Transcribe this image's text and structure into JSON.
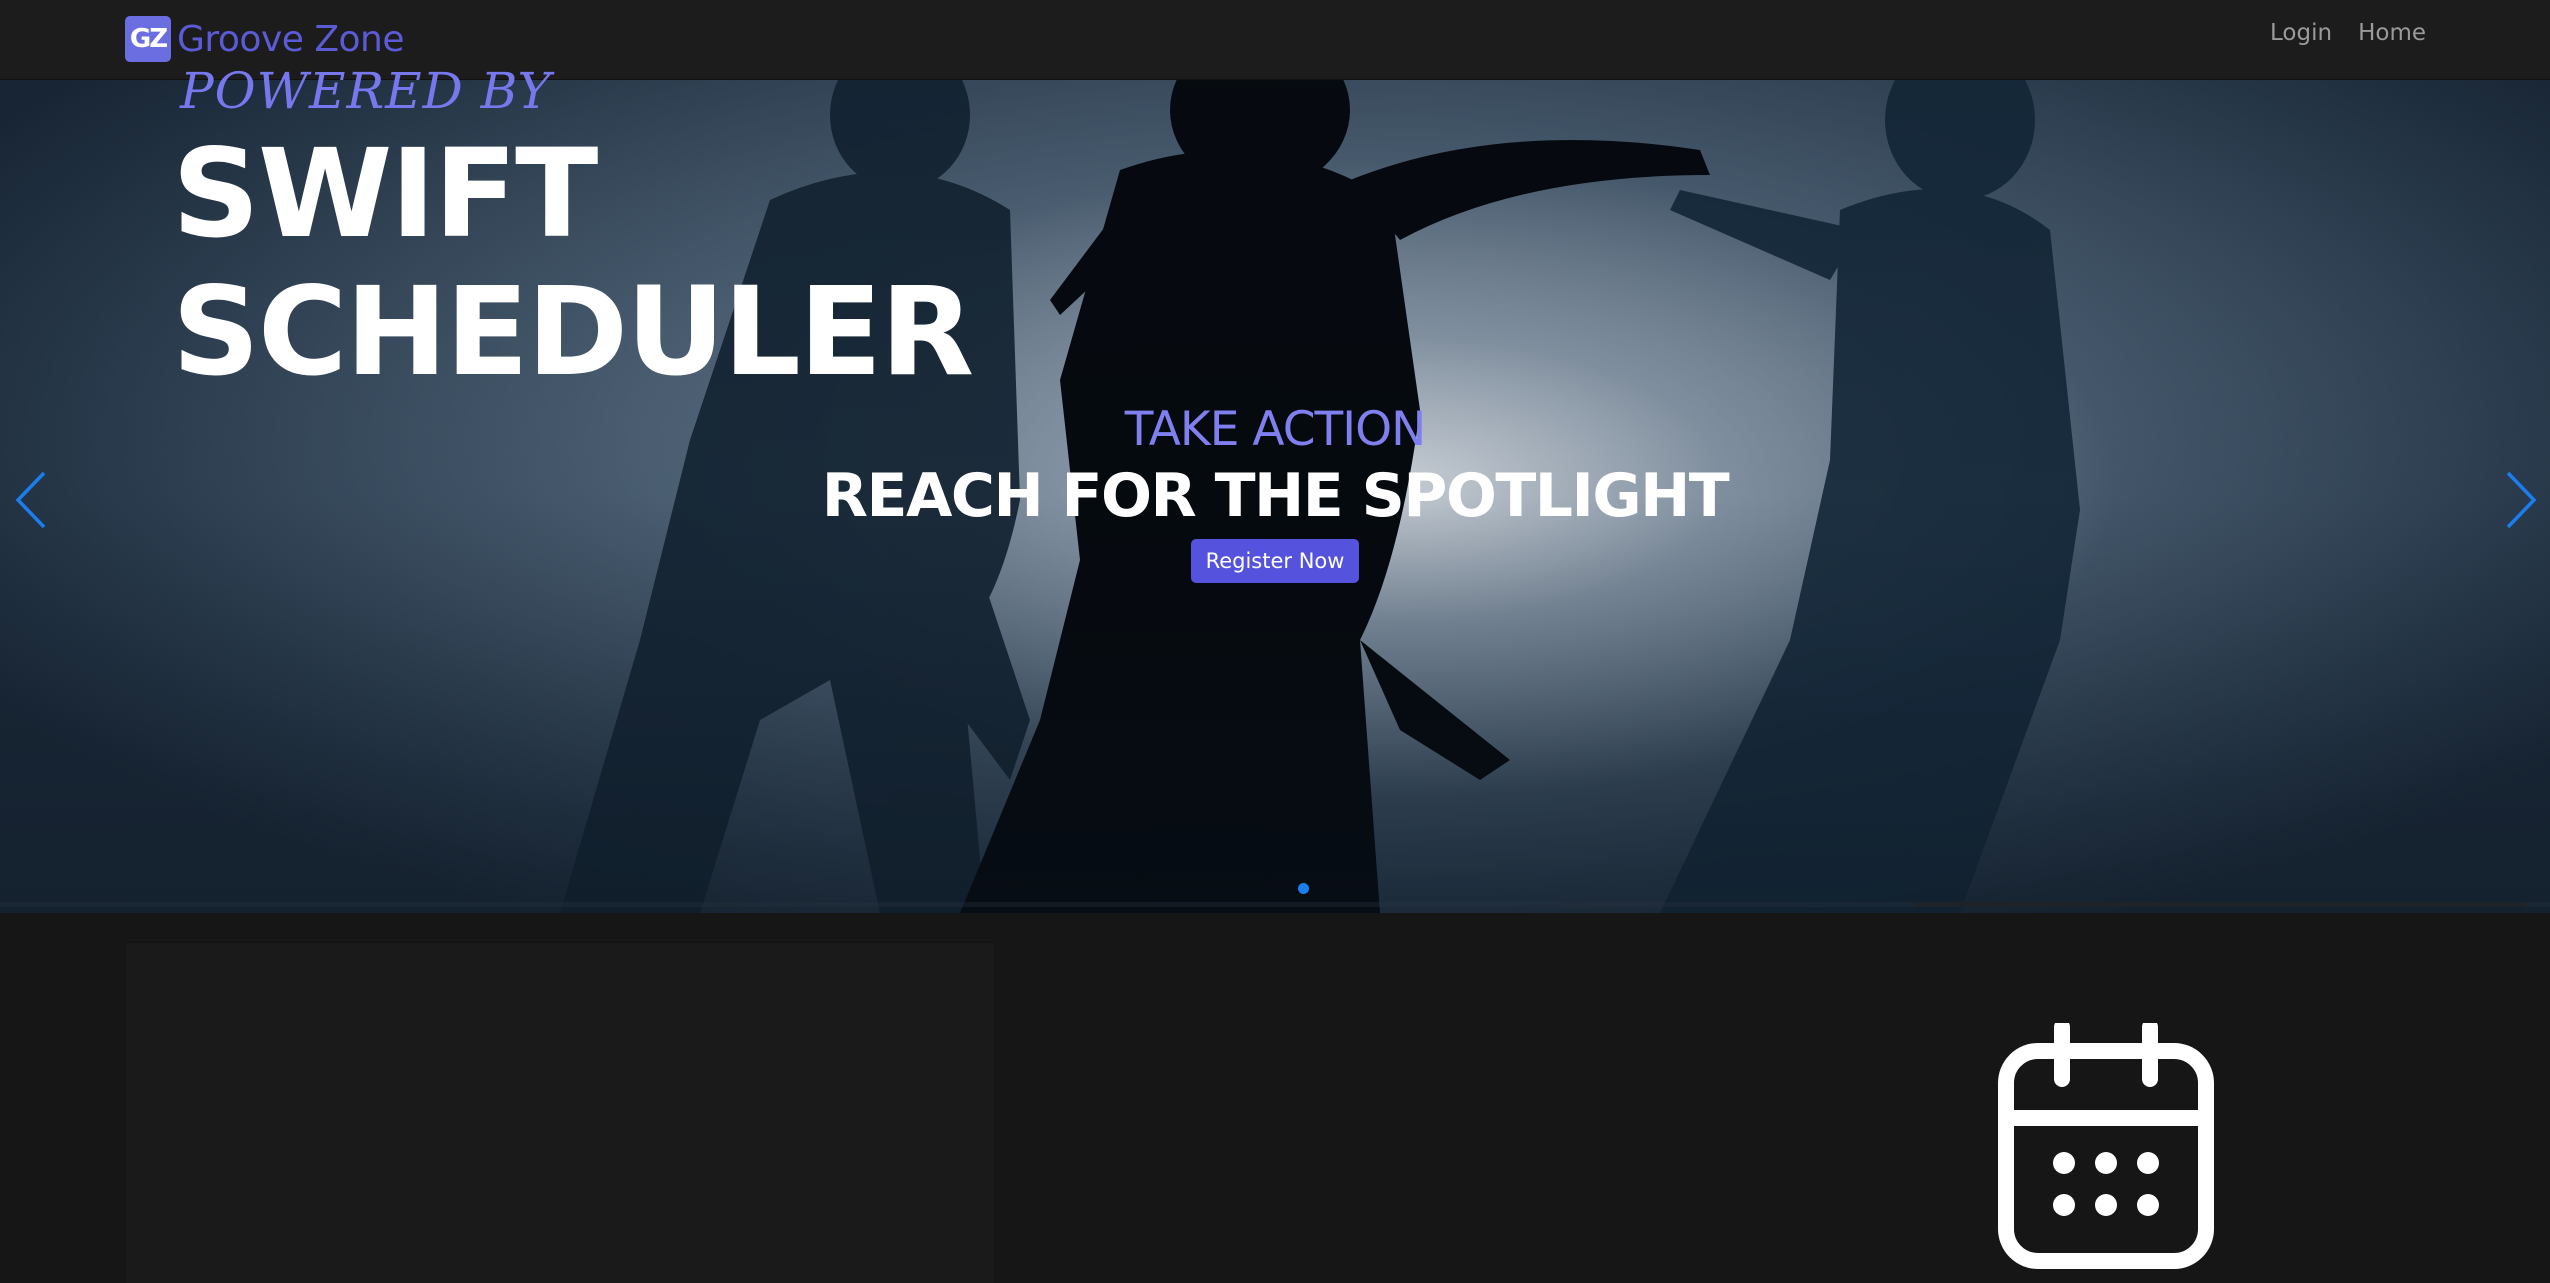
{
  "navbar": {
    "logo_text": "GZ",
    "brand_name": "Groove Zone",
    "links": [
      {
        "label": "Login"
      },
      {
        "label": "Home"
      }
    ]
  },
  "hero": {
    "kicker": "TAKE ACTION",
    "title": "REACH FOR THE SPOTLIGHT",
    "cta_label": "Register Now",
    "prev_icon": "chevron-left-icon",
    "next_icon": "chevron-right-icon",
    "slide_count": 1,
    "active_slide": 1,
    "slide_progress": 0.24
  },
  "feature": {
    "kicker": "POWERED BY",
    "title_line1": "SWIFT",
    "title_line2": "SCHEDULER",
    "icon": "calendar-icon"
  },
  "colors": {
    "brand": "#5b5bd8",
    "accent": "#5552dd",
    "kicker": "#7f7ff0",
    "carousel_control": "#1a7ef0",
    "background": "#161616"
  }
}
